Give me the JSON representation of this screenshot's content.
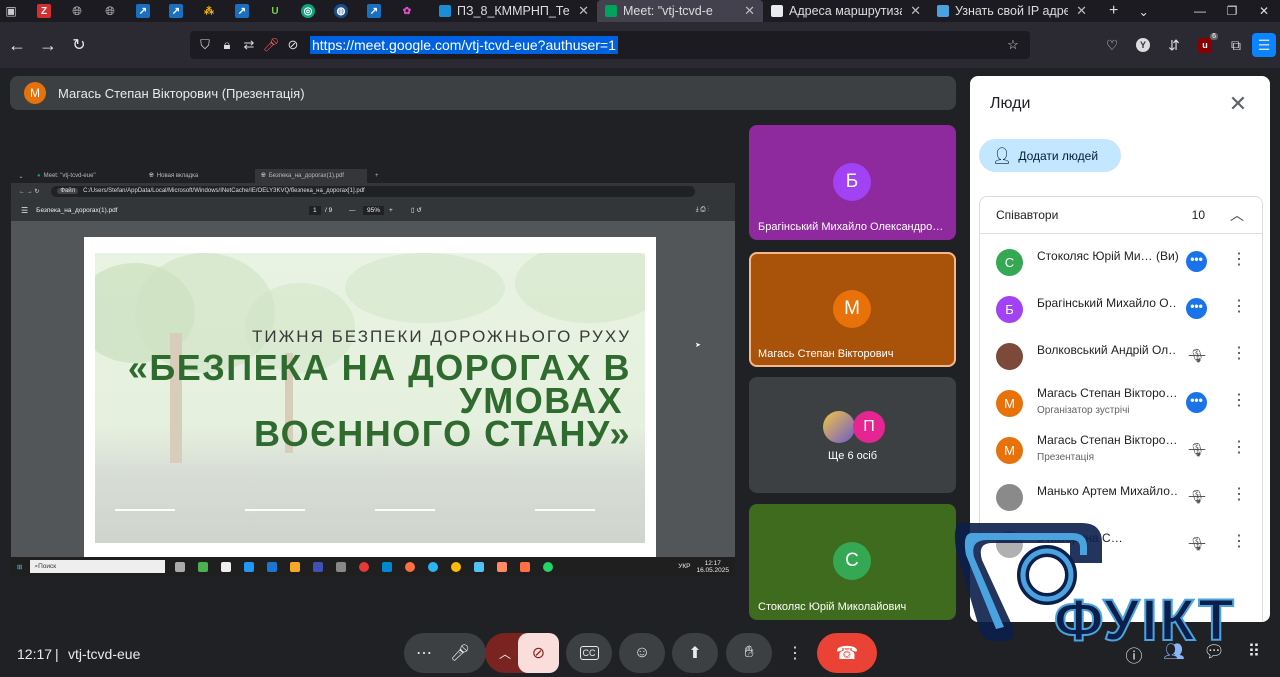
{
  "browser": {
    "tabs": [
      {
        "label": "ПЗ_8_КММРНП_Тем",
        "active": false,
        "color": "#1a8fd8"
      },
      {
        "label": "Meet: \"vtj-tcvd-e",
        "active": true,
        "color": "#00a35c"
      },
      {
        "label": "Адреса маршрутиза",
        "active": false,
        "color": "#e8eaed"
      },
      {
        "label": "Узнать свой IP адре",
        "active": false,
        "color": "#4aa3df"
      }
    ],
    "new_tab": "+",
    "url": "https://meet.google.com/vtj-tcvd-eue?authuser=1",
    "badge_count": "6"
  },
  "presenter": {
    "initial": "М",
    "label": "Магась Степан Вікторович (Презентація)"
  },
  "shared_screen": {
    "tabs": [
      "Meet: \"vtj-tcvd-eue\"",
      "Новая вкладка",
      "Безпека_на_дорогах(1).pdf"
    ],
    "file_label": "Файл",
    "path": "C:/Users/Stefan/AppData/Local/Microsoft/Windows/INetCache/IE/OELY3KVQ/безпека_на_дорогах[1].pdf",
    "pdf_title": "Безпека_на_дорогах(1).pdf",
    "page": "1",
    "page_total": "/ 9",
    "zoom": "95%",
    "slide_subtitle": "ТИЖНЯ БЕЗПЕКИ ДОРОЖНЬОГО РУХУ",
    "slide_title_lines": [
      "«БЕЗПЕКА НА ДОРОГАХ В",
      "УМОВАХ",
      "ВОЄННОГО СТАНУ»"
    ],
    "taskbar_search": "Поиск",
    "taskbar_lang": "УКР",
    "taskbar_time": "12:17",
    "taskbar_date": "16.05.2025"
  },
  "tiles": [
    {
      "initial": "Б",
      "name": "Брагінський Михайло Олександро…",
      "bg": "#8f2a9e",
      "avatar_color": "#a142f4"
    },
    {
      "initial": "М",
      "name": "Магась Степан Вікторович",
      "bg": "#a9520a",
      "avatar_color": "#e8710a"
    },
    {
      "initial": "П",
      "name": "Ще 6 осіб",
      "bg": "#3c4043",
      "avatar_color": "#e52592"
    },
    {
      "initial": "С",
      "name": "Стоколяс Юрій Миколайович",
      "bg": "#3f6b1f",
      "avatar_color": "#34a853"
    }
  ],
  "panel": {
    "title": "Люди",
    "add_label": "Додати людей",
    "section_label": "Співавтори",
    "section_count": "10",
    "people": [
      {
        "initial": "С",
        "name": "Стоколяс Юрій Ми…",
        "suffix": "(Ви)",
        "role": "",
        "status": "speaking",
        "avatar_color": "#34a853"
      },
      {
        "initial": "Б",
        "name": "Брагінський Михайло О…",
        "suffix": "",
        "role": "",
        "status": "speaking",
        "avatar_color": "#a142f4"
      },
      {
        "initial": "",
        "name": "Волковський Андрій Ол…",
        "suffix": "",
        "role": "",
        "status": "muted",
        "avatar_color": "#7b4a3a"
      },
      {
        "initial": "М",
        "name": "Магась Степан Вікторо…",
        "suffix": "",
        "role": "Організатор зустрічі",
        "status": "speaking",
        "avatar_color": "#e8710a"
      },
      {
        "initial": "М",
        "name": "Магась Степан Вікторо…",
        "suffix": "",
        "role": "Презентація",
        "status": "muted-presenting",
        "avatar_color": "#e8710a"
      },
      {
        "initial": "",
        "name": "Манько Артем Михайло…",
        "suffix": "",
        "role": "",
        "status": "muted",
        "avatar_color": "#8a8a8a"
      },
      {
        "initial": "",
        "name": "ь Катерина С…",
        "suffix": "",
        "role": "",
        "status": "muted",
        "avatar_color": "#b0b0b0"
      }
    ]
  },
  "bottom": {
    "time": "12:17",
    "separator": "|",
    "meeting_code": "vtj-tcvd-eue"
  },
  "watermark": {
    "text": "ФУІКТ"
  }
}
